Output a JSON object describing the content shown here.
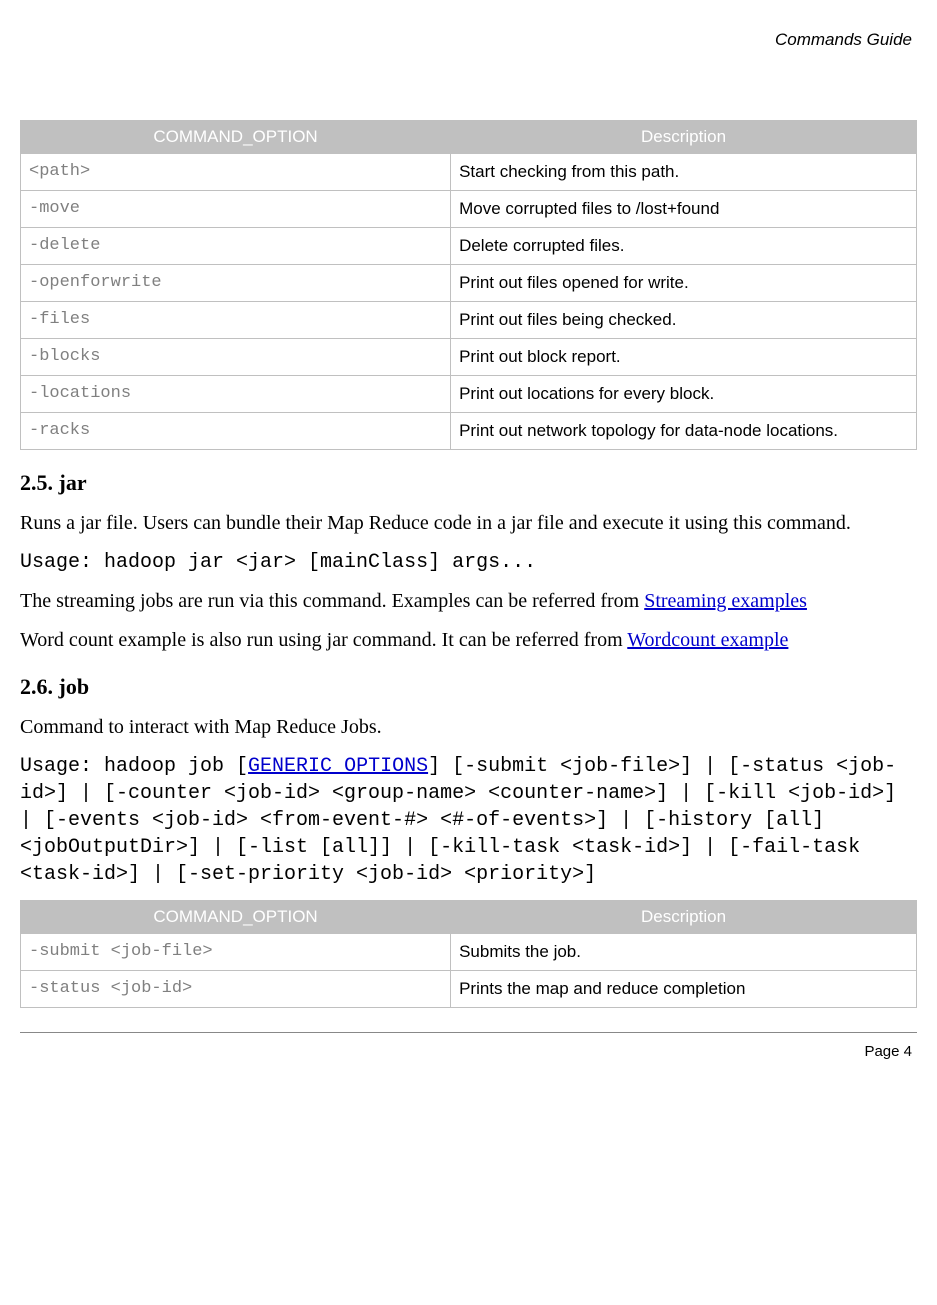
{
  "header": {
    "title": "Commands Guide"
  },
  "table1": {
    "col1": "COMMAND_OPTION",
    "col2": "Description",
    "rows": [
      {
        "opt": "<path>",
        "desc": "Start checking from this path."
      },
      {
        "opt": "-move",
        "desc": "Move corrupted files to /lost+found"
      },
      {
        "opt": "-delete",
        "desc": "Delete corrupted files."
      },
      {
        "opt": "-openforwrite",
        "desc": "Print out files opened for write."
      },
      {
        "opt": "-files",
        "desc": "Print out files being checked."
      },
      {
        "opt": "-blocks",
        "desc": "Print out block report."
      },
      {
        "opt": "-locations",
        "desc": "Print out locations for every block."
      },
      {
        "opt": "-racks",
        "desc": "Print out network topology for data-node locations."
      }
    ]
  },
  "section_jar": {
    "heading": "2.5. jar",
    "para1": "Runs a jar file. Users can bundle their Map Reduce code in a jar file and execute it using this command.",
    "usage": "Usage: hadoop jar <jar> [mainClass] args...",
    "para2_pre": "The streaming jobs are run via this command. Examples can be referred from ",
    "para2_link": "Streaming examples",
    "para3_pre": "Word count example is also run using jar command. It can be referred from ",
    "para3_link": "Wordcount example"
  },
  "section_job": {
    "heading": "2.6. job",
    "para1": "Command to interact with Map Reduce Jobs.",
    "usage_pre": "Usage: hadoop job [",
    "usage_link": "GENERIC_OPTIONS",
    "usage_post": "] [-submit <job-file>] | [-status <job-id>] | [-counter <job-id> <group-name> <counter-name>] | [-kill <job-id>] | [-events <job-id> <from-event-#> <#-of-events>] | [-history [all] <jobOutputDir>] | [-list [all]] | [-kill-task <task-id>] | [-fail-task <task-id>] | [-set-priority <job-id> <priority>]"
  },
  "table2": {
    "col1": "COMMAND_OPTION",
    "col2": "Description",
    "rows": [
      {
        "opt": "-submit <job-file>",
        "desc": "Submits the job."
      },
      {
        "opt": "-status <job-id>",
        "desc": "Prints the map and reduce completion"
      }
    ]
  },
  "footer": {
    "page": "Page 4"
  }
}
